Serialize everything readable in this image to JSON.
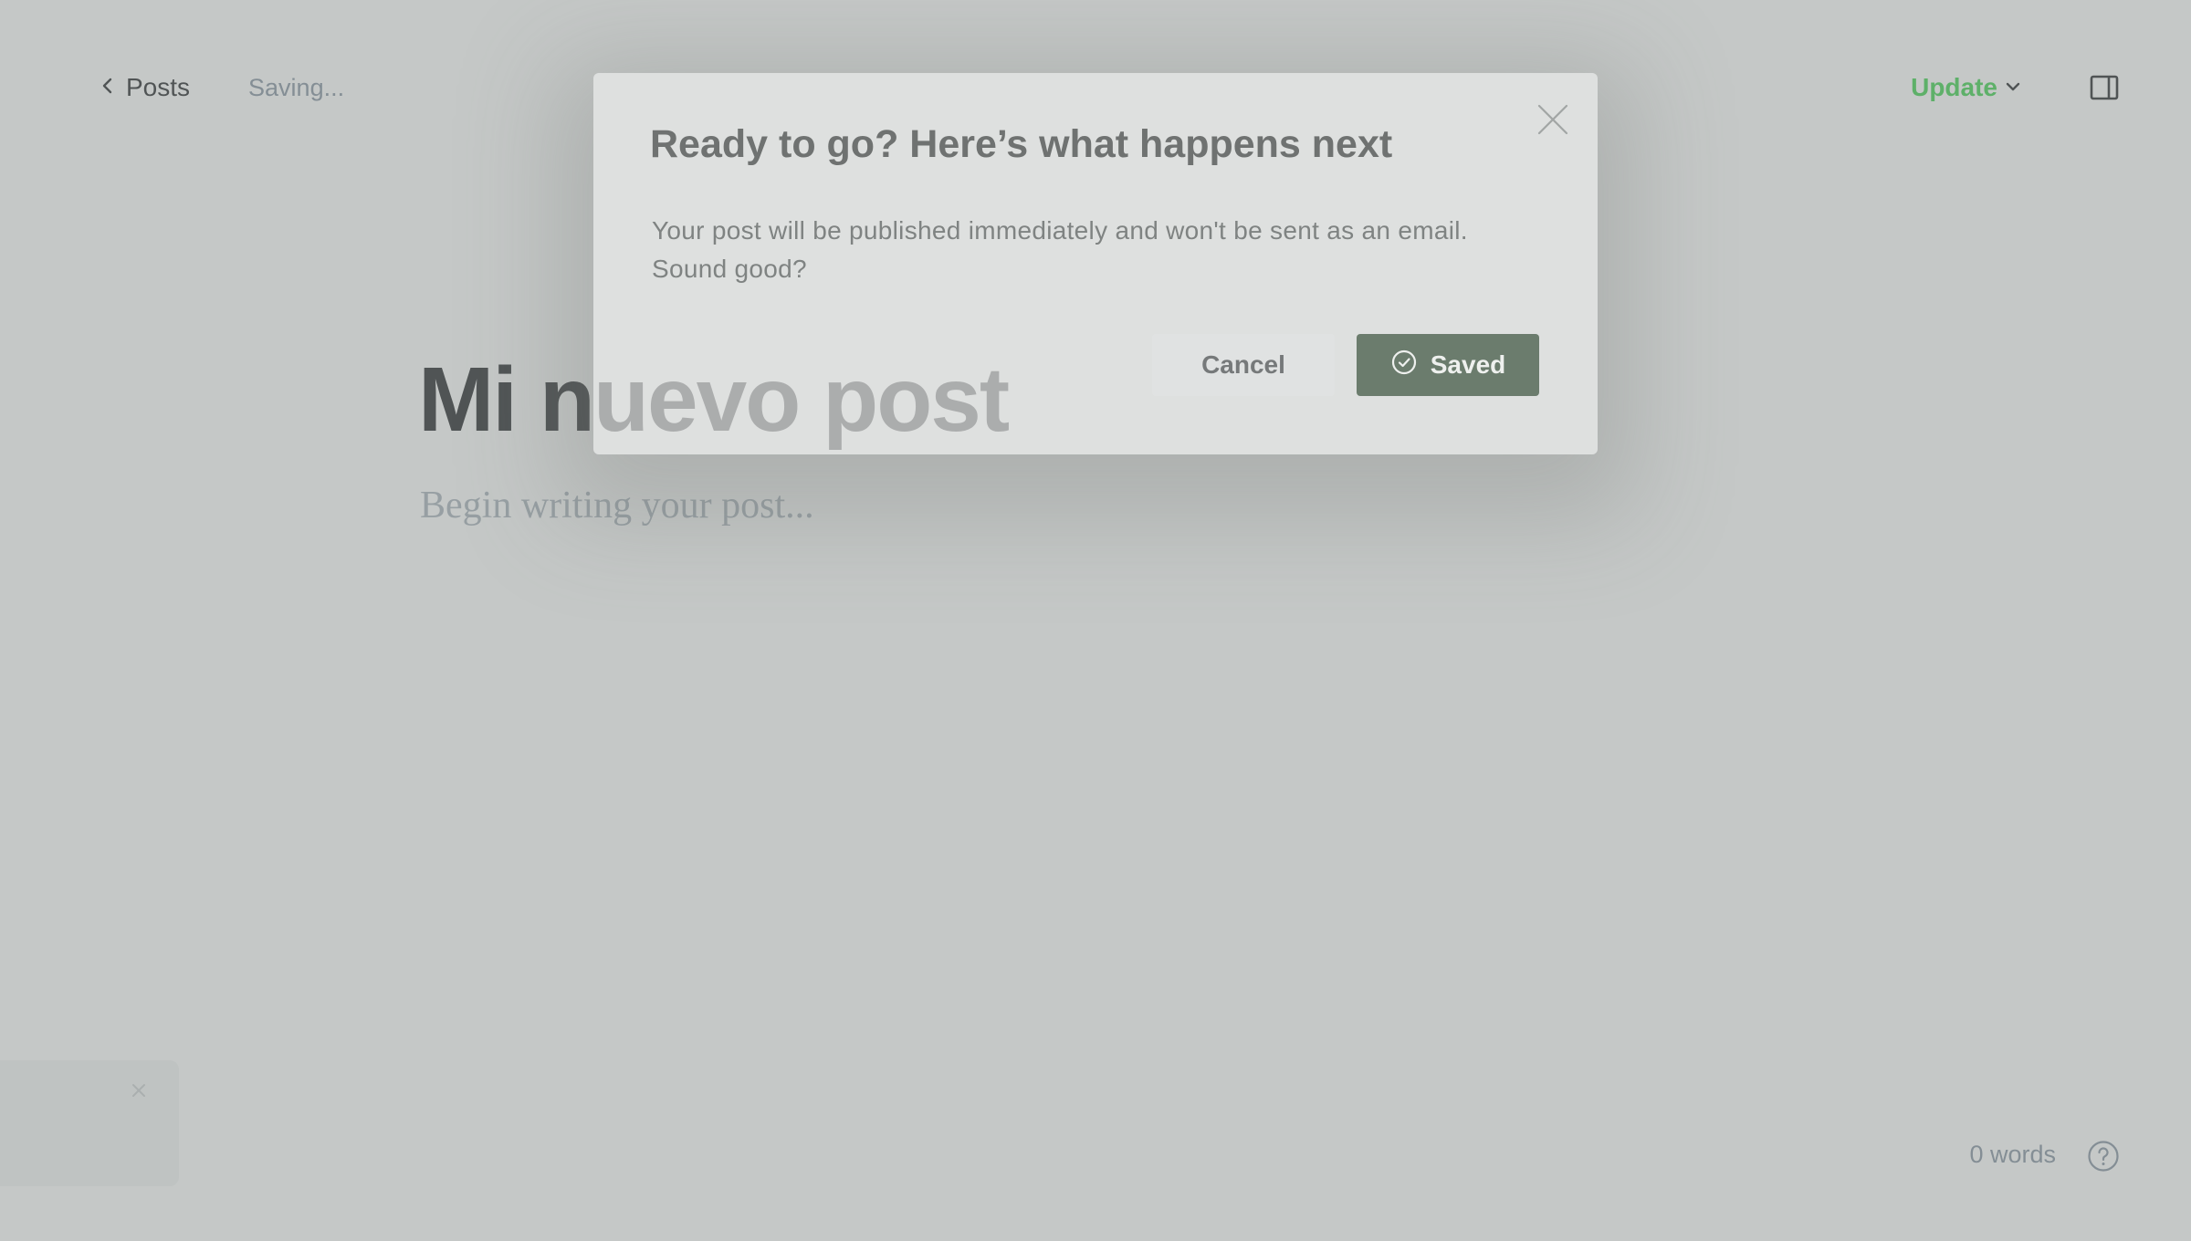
{
  "header": {
    "back_label": "Posts",
    "status_text": "Saving...",
    "update_label": "Update"
  },
  "post": {
    "title": "Mi nuevo post",
    "body_placeholder": "Begin writing your post..."
  },
  "footer": {
    "word_count": "0 words"
  },
  "modal": {
    "title": "Ready to go? Here’s what happens next",
    "body": "Your post will be published immediately and won't be sent as an email. Sound good?",
    "cancel_label": "Cancel",
    "confirm_label": "Saved"
  },
  "colors": {
    "accent_green": "#30cf43",
    "saved_button": "#6b7c6d",
    "title_text": "#15171a"
  },
  "icons": {
    "back": "chevron-left-icon",
    "update_dropdown": "chevron-down-icon",
    "sidebar_toggle": "sidebar-panel-icon",
    "help": "question-circle-icon",
    "modal_close": "close-icon",
    "saved": "check-circle-icon",
    "toast_close": "close-icon"
  }
}
